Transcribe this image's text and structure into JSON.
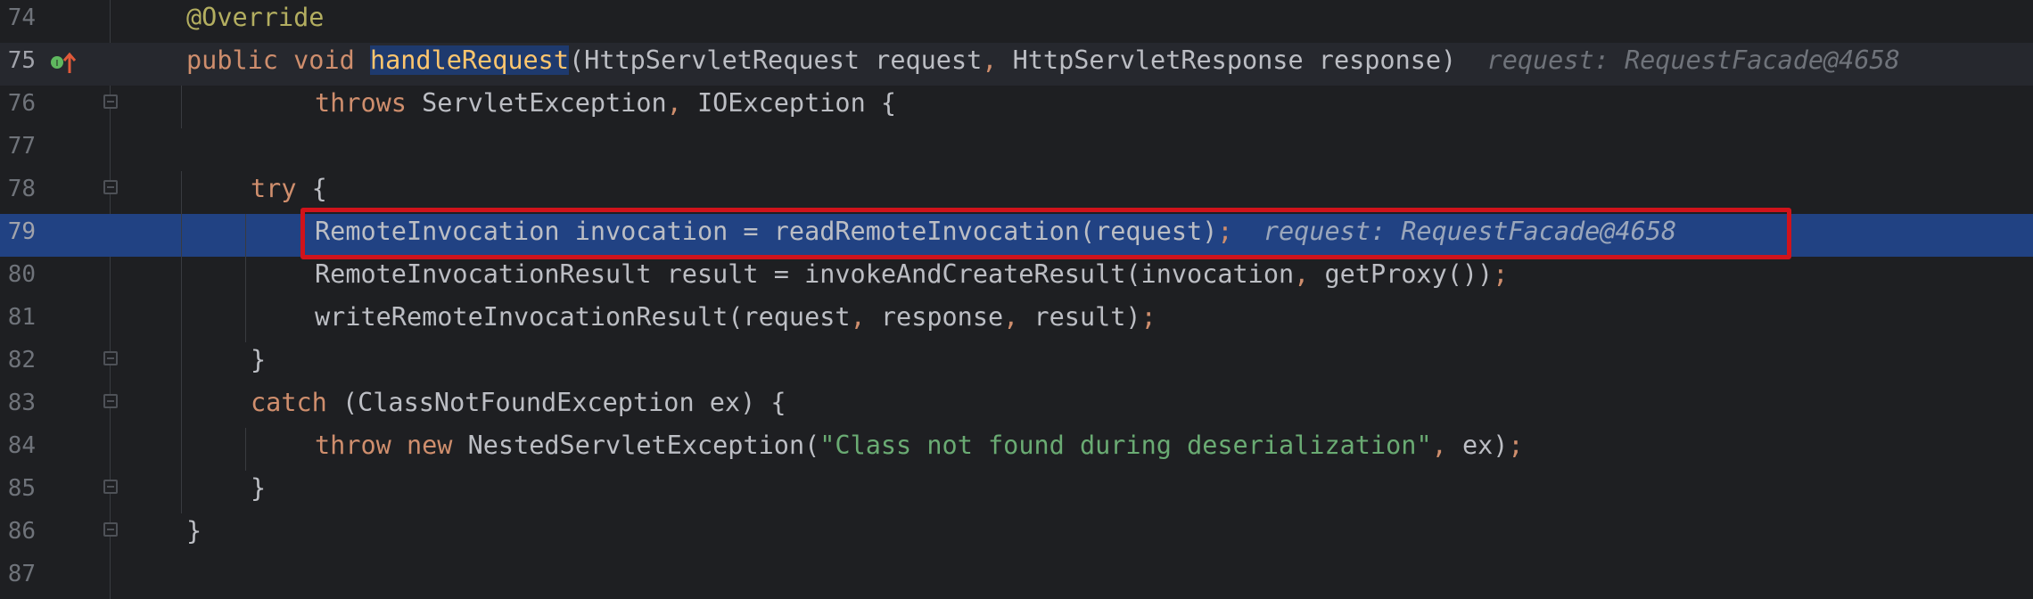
{
  "editor": {
    "lines": [
      {
        "number": "74",
        "tokens": [
          {
            "t": "ann",
            "v": "@Override"
          }
        ]
      },
      {
        "number": "75",
        "tokens": [
          {
            "t": "kw",
            "v": "public"
          },
          {
            "t": "plain",
            "v": " "
          },
          {
            "t": "kw",
            "v": "void"
          },
          {
            "t": "plain",
            "v": " "
          },
          {
            "t": "fnhl",
            "v": "handleRequest"
          },
          {
            "t": "plain",
            "v": "(HttpServletRequest request"
          },
          {
            "t": "kw",
            "v": ","
          },
          {
            "t": "plain",
            "v": " HttpServletResponse response)"
          },
          {
            "t": "hint",
            "v": "  request: RequestFacade@4658"
          }
        ]
      },
      {
        "number": "76",
        "tokens": [
          {
            "t": "kw",
            "v": "throws"
          },
          {
            "t": "plain",
            "v": " ServletException"
          },
          {
            "t": "kw",
            "v": ","
          },
          {
            "t": "plain",
            "v": " IOException {"
          }
        ]
      },
      {
        "number": "77",
        "tokens": []
      },
      {
        "number": "78",
        "tokens": [
          {
            "t": "kw",
            "v": "try"
          },
          {
            "t": "plain",
            "v": " {"
          }
        ]
      },
      {
        "number": "79",
        "tokens": [
          {
            "t": "plain",
            "v": "RemoteInvocation invocation = readRemoteInvocation(request)"
          },
          {
            "t": "kw",
            "v": ";"
          },
          {
            "t": "hint",
            "v": "  request: RequestFacade@4658"
          }
        ]
      },
      {
        "number": "80",
        "tokens": [
          {
            "t": "plain",
            "v": "RemoteInvocationResult result = invokeAndCreateResult(invocation"
          },
          {
            "t": "kw",
            "v": ","
          },
          {
            "t": "plain",
            "v": " getProxy())"
          },
          {
            "t": "kw",
            "v": ";"
          }
        ]
      },
      {
        "number": "81",
        "tokens": [
          {
            "t": "plain",
            "v": "writeRemoteInvocationResult(request"
          },
          {
            "t": "kw",
            "v": ","
          },
          {
            "t": "plain",
            "v": " response"
          },
          {
            "t": "kw",
            "v": ","
          },
          {
            "t": "plain",
            "v": " result)"
          },
          {
            "t": "kw",
            "v": ";"
          }
        ]
      },
      {
        "number": "82",
        "tokens": [
          {
            "t": "plain",
            "v": "}"
          }
        ]
      },
      {
        "number": "83",
        "tokens": [
          {
            "t": "kw",
            "v": "catch"
          },
          {
            "t": "plain",
            "v": " (ClassNotFoundException ex) {"
          }
        ]
      },
      {
        "number": "84",
        "tokens": [
          {
            "t": "kw",
            "v": "throw"
          },
          {
            "t": "plain",
            "v": " "
          },
          {
            "t": "kw",
            "v": "new"
          },
          {
            "t": "plain",
            "v": " NestedServletException("
          },
          {
            "t": "str",
            "v": "\"Class not found during deserialization\""
          },
          {
            "t": "kw",
            "v": ","
          },
          {
            "t": "plain",
            "v": " ex)"
          },
          {
            "t": "kw",
            "v": ";"
          }
        ]
      },
      {
        "number": "85",
        "tokens": [
          {
            "t": "plain",
            "v": "}"
          }
        ]
      },
      {
        "number": "86",
        "tokens": [
          {
            "t": "plain",
            "v": "}"
          }
        ]
      },
      {
        "number": "87",
        "tokens": []
      }
    ],
    "current_line": "75",
    "highlighted_line": "79",
    "gutter_icons": {
      "override": "override-icon",
      "breakpoint_fold": "fold-icon"
    },
    "colors": {
      "background": "#1e1f22",
      "highlight": "#214283",
      "keyword": "#cf8e6d",
      "annotation": "#b3ae60",
      "string": "#6aab73",
      "inlay_hint": "#6f737a",
      "focus_box": "#d0131b"
    }
  }
}
